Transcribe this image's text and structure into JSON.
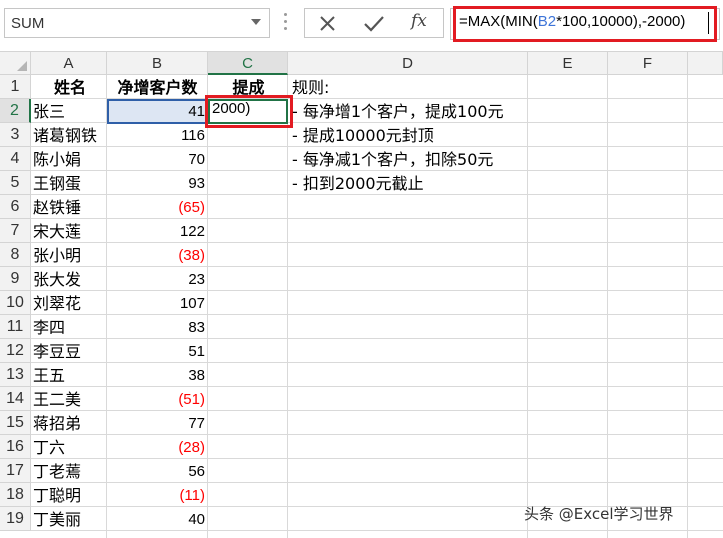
{
  "name_box": {
    "value": "SUM"
  },
  "formula_bar": {
    "cancel_icon": "close-icon",
    "enter_icon": "checkmark-icon",
    "fx_label": "fx",
    "formula_prefix": "=MAX(MIN(",
    "formula_ref": "B2",
    "formula_suffix": "*100,10000),-2000)"
  },
  "columns": [
    "A",
    "B",
    "C",
    "D",
    "E",
    "F"
  ],
  "rows": [
    "1",
    "2",
    "3",
    "4",
    "5",
    "6",
    "7",
    "8",
    "9",
    "10",
    "11",
    "12",
    "13",
    "14",
    "15",
    "16",
    "17",
    "18",
    "19"
  ],
  "headers": {
    "name": "姓名",
    "customers": "净增客户数",
    "commission": "提成"
  },
  "data_rows": [
    {
      "name": "张三",
      "value": "41",
      "negative": false
    },
    {
      "name": "诸葛钢铁",
      "value": "116",
      "negative": false
    },
    {
      "name": "陈小娟",
      "value": "70",
      "negative": false
    },
    {
      "name": "王钢蛋",
      "value": "93",
      "negative": false
    },
    {
      "name": "赵铁锤",
      "value": "(65)",
      "negative": true
    },
    {
      "name": "宋大莲",
      "value": "122",
      "negative": false
    },
    {
      "name": "张小明",
      "value": "(38)",
      "negative": true
    },
    {
      "name": "张大发",
      "value": "23",
      "negative": false
    },
    {
      "name": "刘翠花",
      "value": "107",
      "negative": false
    },
    {
      "name": "李四",
      "value": "83",
      "negative": false
    },
    {
      "name": "李豆豆",
      "value": "51",
      "negative": false
    },
    {
      "name": "王五",
      "value": "38",
      "negative": false
    },
    {
      "name": "王二美",
      "value": "(51)",
      "negative": true
    },
    {
      "name": "蒋招弟",
      "value": "77",
      "negative": false
    },
    {
      "name": "丁六",
      "value": "(28)",
      "negative": true
    },
    {
      "name": "丁老蔫",
      "value": "56",
      "negative": false
    },
    {
      "name": "丁聪明",
      "value": "(11)",
      "negative": true
    },
    {
      "name": "丁美丽",
      "value": "40",
      "negative": false
    }
  ],
  "active_cell_text": "2000)",
  "rules": [
    "规则:",
    "- 每净增1个客户，提成100元",
    "- 提成10000元封顶",
    "- 每净减1个客户，扣除50元",
    "- 扣到2000元截止"
  ],
  "watermark": "头条 @Excel学习世界",
  "colors": {
    "negative": "#ff0000",
    "highlight": "#e21b22",
    "selection": "#217346",
    "reference": "#3d74d8"
  }
}
